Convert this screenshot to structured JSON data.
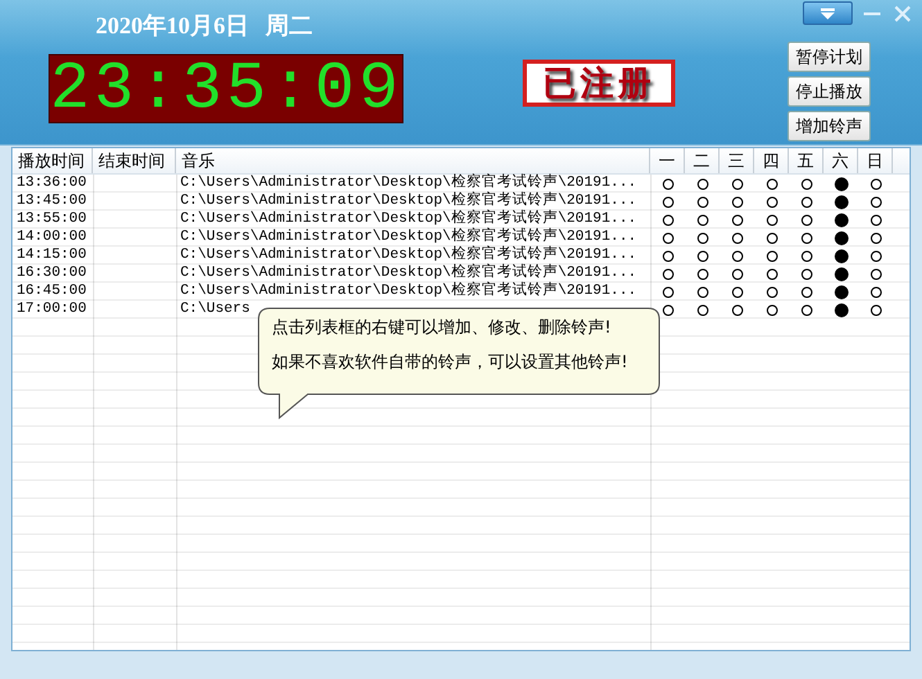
{
  "header": {
    "date": "2020年10月6日",
    "weekday": "周二",
    "clock": "23:35:09",
    "badge": "已注册",
    "window_controls": [
      {
        "kind": "dropdown"
      },
      {
        "kind": "minimize"
      },
      {
        "kind": "close"
      }
    ],
    "buttons": [
      "暂停计划",
      "停止播放",
      "增加铃声"
    ]
  },
  "table": {
    "columns": [
      "播放时间",
      "结束时间",
      "音乐",
      "一",
      "二",
      "三",
      "四",
      "五",
      "六",
      "日"
    ],
    "rows": [
      {
        "start": "13:36:00",
        "music": "C:\\Users\\Administrator\\Desktop\\检察官考试铃声\\20191...",
        "days": [
          false,
          false,
          false,
          false,
          false,
          true,
          false
        ]
      },
      {
        "start": "13:45:00",
        "music": "C:\\Users\\Administrator\\Desktop\\检察官考试铃声\\20191...",
        "days": [
          false,
          false,
          false,
          false,
          false,
          true,
          false
        ]
      },
      {
        "start": "13:55:00",
        "music": "C:\\Users\\Administrator\\Desktop\\检察官考试铃声\\20191...",
        "days": [
          false,
          false,
          false,
          false,
          false,
          true,
          false
        ]
      },
      {
        "start": "14:00:00",
        "music": "C:\\Users\\Administrator\\Desktop\\检察官考试铃声\\20191...",
        "days": [
          false,
          false,
          false,
          false,
          false,
          true,
          false
        ]
      },
      {
        "start": "14:15:00",
        "music": "C:\\Users\\Administrator\\Desktop\\检察官考试铃声\\20191...",
        "days": [
          false,
          false,
          false,
          false,
          false,
          true,
          false
        ]
      },
      {
        "start": "16:30:00",
        "music": "C:\\Users\\Administrator\\Desktop\\检察官考试铃声\\20191...",
        "days": [
          false,
          false,
          false,
          false,
          false,
          true,
          false
        ]
      },
      {
        "start": "16:45:00",
        "music": "C:\\Users\\Administrator\\Desktop\\检察官考试铃声\\20191...",
        "days": [
          false,
          false,
          false,
          false,
          false,
          true,
          false
        ]
      },
      {
        "start": "17:00:00",
        "music": "C:\\Users",
        "days": [
          false,
          false,
          false,
          false,
          false,
          true,
          false
        ]
      }
    ]
  },
  "tooltip": {
    "lines": [
      "点击列表框的右键可以增加、修改、删除铃声!",
      "如果不喜欢软件自带的铃声，可以设置其他铃声!"
    ]
  }
}
